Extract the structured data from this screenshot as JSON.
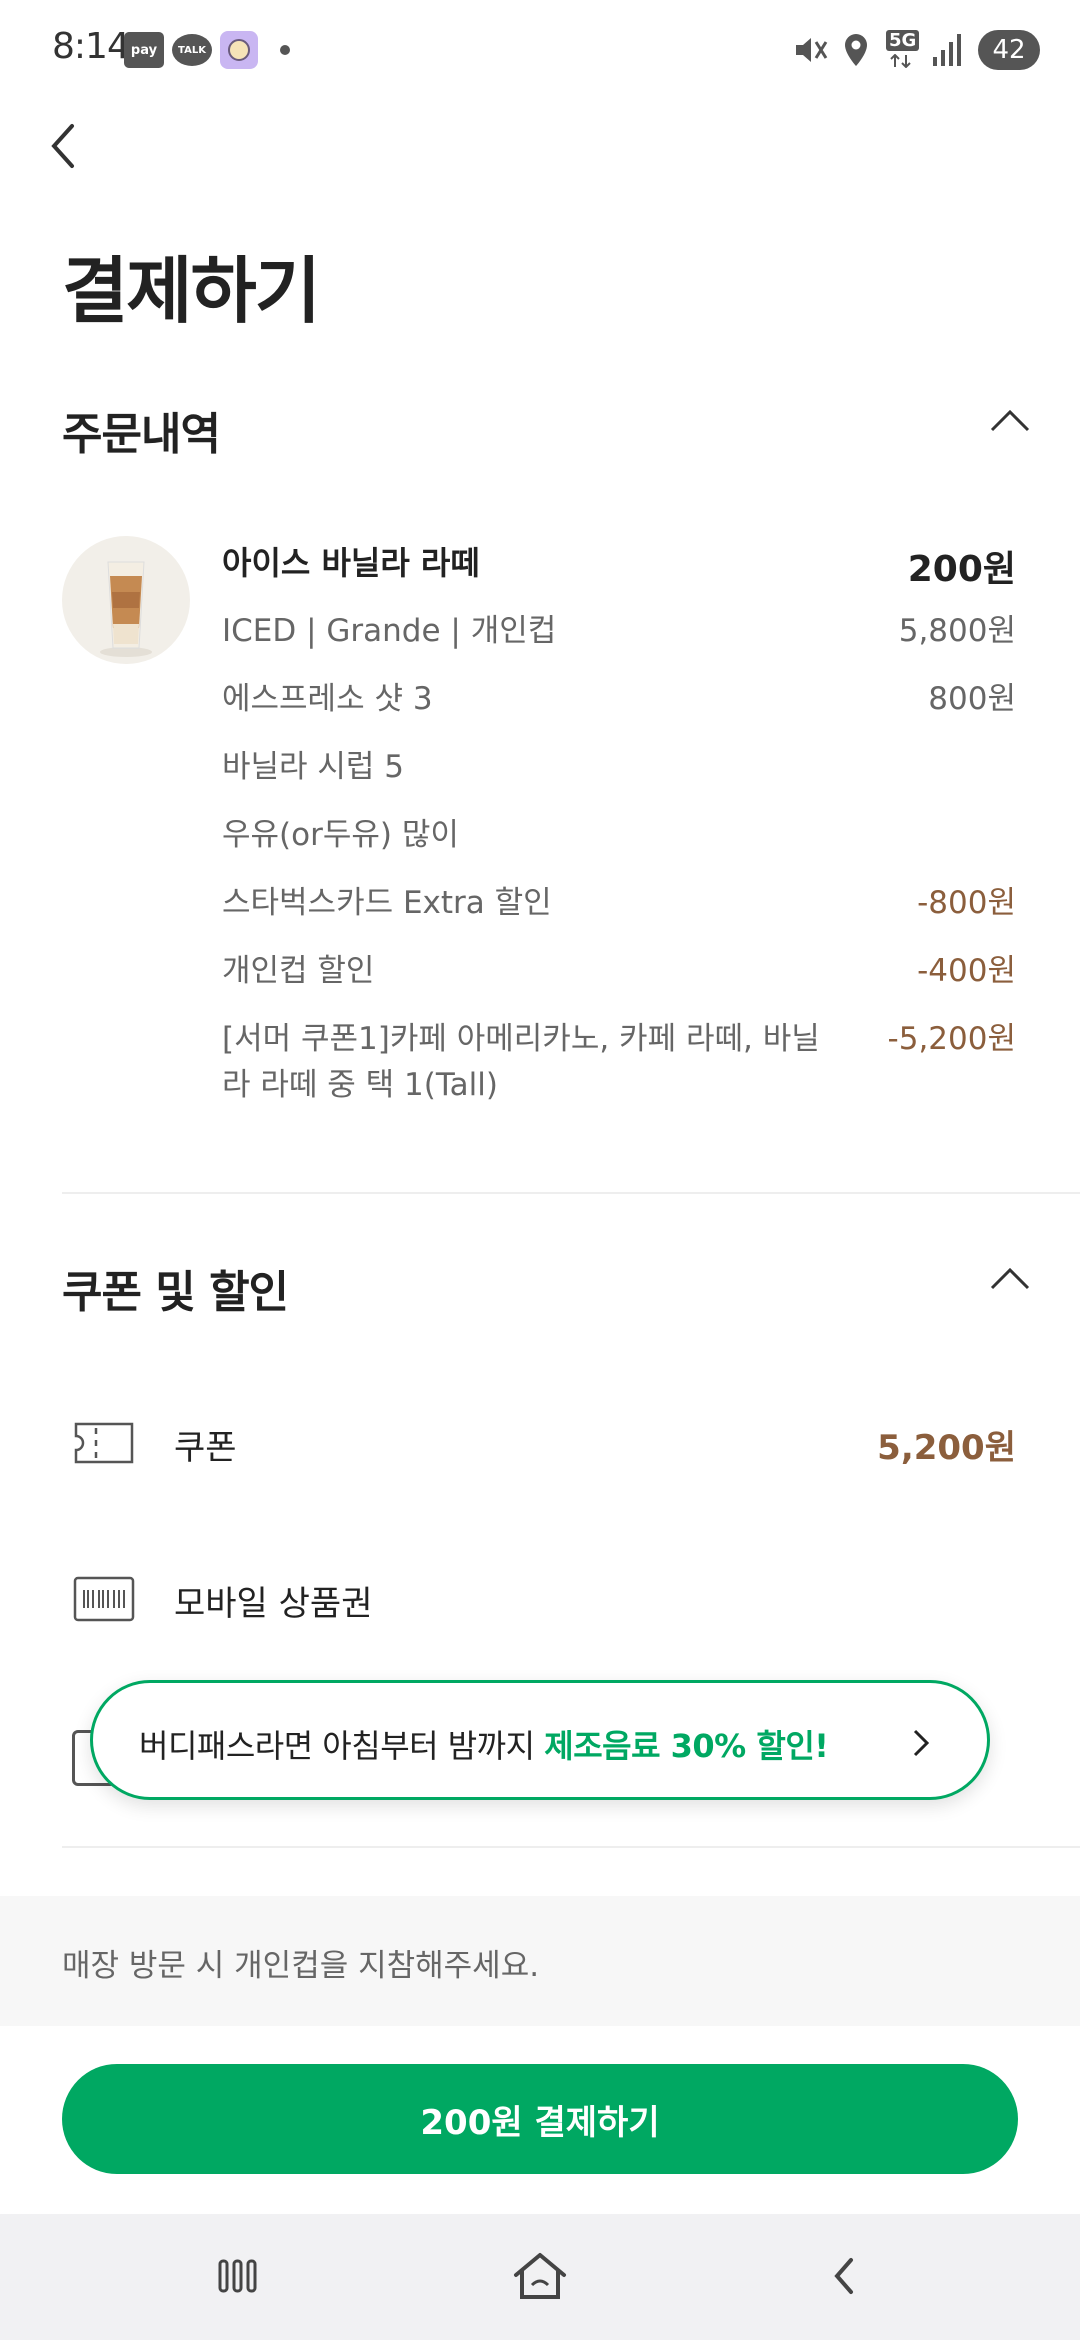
{
  "status_bar": {
    "time": "8:14",
    "pay_badge": "pay",
    "talk_badge": "TALK",
    "network": "5G",
    "battery": "42",
    "icons": [
      "pay-icon",
      "talk-icon",
      "avatar-icon",
      "mute-icon",
      "location-icon",
      "5g-icon",
      "signal-icon",
      "battery-icon"
    ]
  },
  "header": {
    "title": "결제하기"
  },
  "order_section": {
    "title": "주문내역",
    "item": {
      "name": "아이스 바닐라 라떼",
      "total": "200원",
      "options": [
        {
          "label": "ICED | Grande | 개인컵",
          "price": "5,800원"
        },
        {
          "label": "에스프레소 샷 3",
          "price": "800원"
        },
        {
          "label": "바닐라 시럽 5",
          "price": ""
        },
        {
          "label": "우유(or두유) 많이",
          "price": ""
        },
        {
          "label": "스타벅스카드 Extra 할인",
          "price": "-800원"
        },
        {
          "label": "개인컵 할인",
          "price": "-400원"
        }
      ],
      "coupon_line": {
        "label": "[서머 쿠폰1]카페 아메리카노, 카페 라떼, 바닐라 라떼 중 택 1(Tall)",
        "price": "-5,200원"
      }
    }
  },
  "discount_section": {
    "title": "쿠폰 및 할인",
    "coupon": {
      "label": "쿠폰",
      "value": "5,200원"
    },
    "gift_card": {
      "label": "모바일 상품권"
    }
  },
  "promo": {
    "prefix": "버디패스라면 아침부터 밤까지 ",
    "highlight": "제조음료 30% 할인!"
  },
  "notice": "매장 방문 시 개인컵을 지참해주세요.",
  "pay_button": "200원 결제하기",
  "colors": {
    "brand_green": "#00a862",
    "discount_brown": "#8b5e3c"
  }
}
